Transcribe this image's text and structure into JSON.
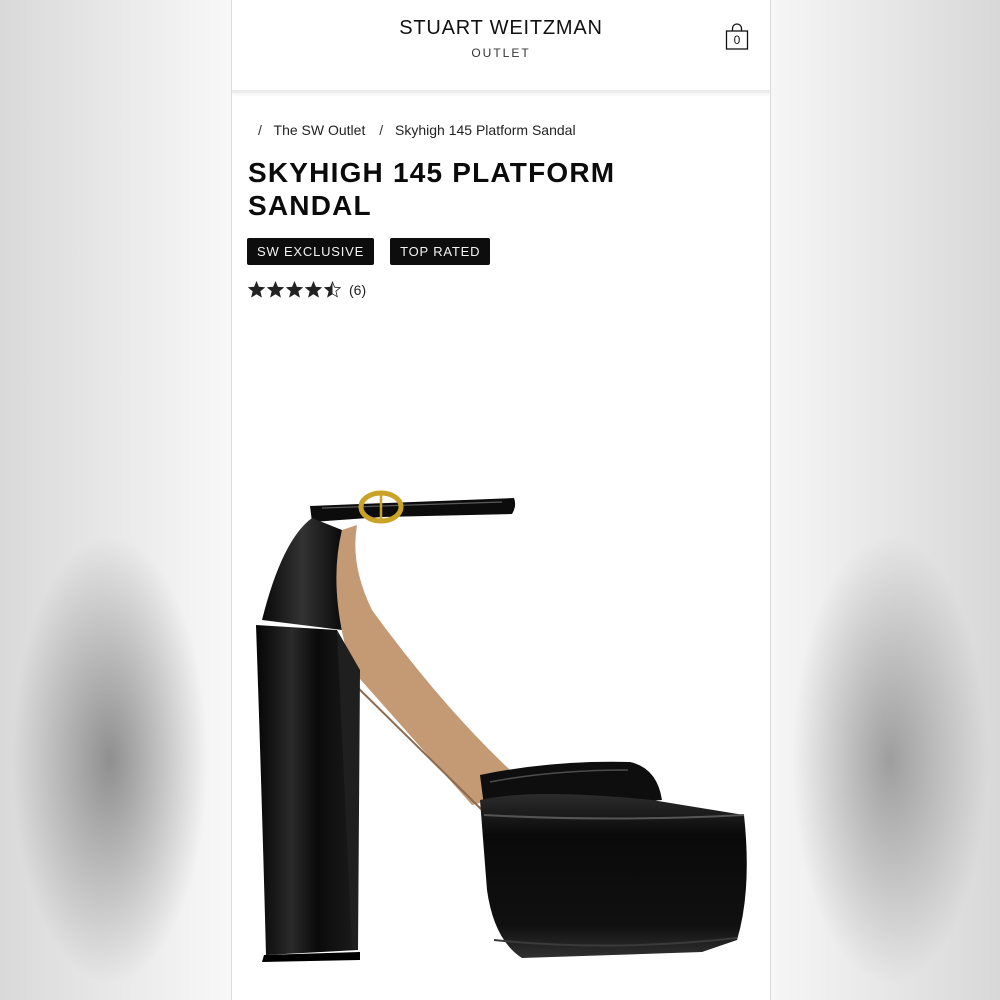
{
  "header": {
    "brand": "STUART WEITZMAN",
    "sub_brand": "OUTLET",
    "bag_count": "0"
  },
  "breadcrumb": {
    "items": [
      "The SW Outlet",
      "Skyhigh 145 Platform Sandal"
    ],
    "separator": "/"
  },
  "product": {
    "title": "SKYHIGH 145 PLATFORM SANDAL",
    "badges": [
      "SW EXCLUSIVE",
      "TOP RATED"
    ],
    "rating": 4.5,
    "review_count": "(6)",
    "image_icon": "black-patent-platform-sandal"
  },
  "colors": {
    "badge_bg": "#0d0d0d",
    "text": "#111111",
    "buckle": "#c9a227"
  }
}
